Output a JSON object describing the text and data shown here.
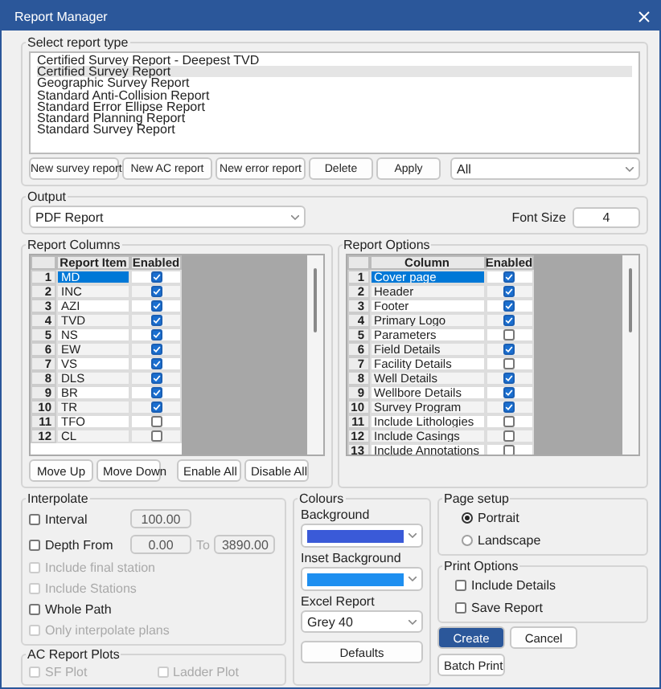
{
  "window": {
    "title": "Report Manager"
  },
  "report_type": {
    "label": "Select report type",
    "items": [
      {
        "label": "Certified Survey Report - Deepest TVD",
        "selected": false
      },
      {
        "label": "Certified Survey Report",
        "selected": true
      },
      {
        "label": "Geographic Survey Report",
        "selected": false
      },
      {
        "label": "Standard Anti-Collision Report",
        "selected": false
      },
      {
        "label": "Standard Error Ellipse Report",
        "selected": false
      },
      {
        "label": "Standard Planning Report",
        "selected": false
      },
      {
        "label": "Standard Survey Report",
        "selected": false
      }
    ],
    "buttons": [
      "New survey report",
      "New AC report",
      "New error report",
      "Delete",
      "Apply"
    ],
    "filter": {
      "value": "All"
    }
  },
  "output": {
    "label": "Output",
    "format": {
      "value": "PDF Report"
    },
    "font_size": {
      "label": "Font Size",
      "value": "4"
    }
  },
  "report_columns": {
    "label": "Report Columns",
    "headers": [
      "Report Item",
      "Enabled"
    ],
    "rows": [
      {
        "number": "1",
        "item": "MD",
        "enabled": true,
        "selected": true
      },
      {
        "number": "2",
        "item": "INC",
        "enabled": true,
        "selected": false
      },
      {
        "number": "3",
        "item": "AZI",
        "enabled": true,
        "selected": false
      },
      {
        "number": "4",
        "item": "TVD",
        "enabled": true,
        "selected": false
      },
      {
        "number": "5",
        "item": "NS",
        "enabled": true,
        "selected": false
      },
      {
        "number": "6",
        "item": "EW",
        "enabled": true,
        "selected": false
      },
      {
        "number": "7",
        "item": "VS",
        "enabled": true,
        "selected": false
      },
      {
        "number": "8",
        "item": "DLS",
        "enabled": true,
        "selected": false
      },
      {
        "number": "9",
        "item": "BR",
        "enabled": true,
        "selected": false
      },
      {
        "number": "10",
        "item": "TR",
        "enabled": true,
        "selected": false
      },
      {
        "number": "11",
        "item": "TFO",
        "enabled": false,
        "selected": false
      },
      {
        "number": "12",
        "item": "CL",
        "enabled": false,
        "selected": false
      }
    ],
    "buttons": [
      "Move Up",
      "Move Down",
      "Enable All",
      "Disable All"
    ]
  },
  "report_options": {
    "label": "Report Options",
    "headers": [
      "Column",
      "Enabled"
    ],
    "rows": [
      {
        "number": "1",
        "item": "Cover page",
        "enabled": true,
        "selected": true
      },
      {
        "number": "2",
        "item": "Header",
        "enabled": true,
        "selected": false
      },
      {
        "number": "3",
        "item": "Footer",
        "enabled": true,
        "selected": false
      },
      {
        "number": "4",
        "item": "Primary Logo",
        "enabled": true,
        "selected": false
      },
      {
        "number": "5",
        "item": "Parameters",
        "enabled": false,
        "selected": false
      },
      {
        "number": "6",
        "item": "Field Details",
        "enabled": true,
        "selected": false
      },
      {
        "number": "7",
        "item": "Facility Details",
        "enabled": false,
        "selected": false
      },
      {
        "number": "8",
        "item": "Well Details",
        "enabled": true,
        "selected": false
      },
      {
        "number": "9",
        "item": "Wellbore Details",
        "enabled": true,
        "selected": false
      },
      {
        "number": "10",
        "item": "Survey Program",
        "enabled": true,
        "selected": false
      },
      {
        "number": "11",
        "item": "Include Lithologies",
        "enabled": false,
        "selected": false
      },
      {
        "number": "12",
        "item": "Include Casings",
        "enabled": false,
        "selected": false
      },
      {
        "number": "13",
        "item": "Include Annotations",
        "enabled": false,
        "selected": false
      }
    ]
  },
  "interpolate": {
    "label": "Interpolate",
    "options": [
      {
        "kind": "field",
        "label": "Interval",
        "checked": false,
        "disabled": false,
        "value": "100.00"
      },
      {
        "kind": "range",
        "label": "Depth From",
        "checked": false,
        "disabled": false,
        "value": "0.00",
        "to_label": "To",
        "to_value": "3890.00"
      },
      {
        "kind": "plain",
        "label": "Include final station",
        "checked": false,
        "disabled": true
      },
      {
        "kind": "plain",
        "label": "Include Stations",
        "checked": false,
        "disabled": true
      },
      {
        "kind": "plain",
        "label": "Whole Path",
        "checked": false,
        "disabled": false
      },
      {
        "kind": "plain",
        "label": "Only interpolate plans",
        "checked": false,
        "disabled": true
      }
    ]
  },
  "ac_report_plots": {
    "label": "AC Report Plots",
    "options": [
      {
        "label": "SF Plot",
        "checked": false,
        "disabled": true
      },
      {
        "label": "Ladder Plot",
        "checked": false,
        "disabled": true
      }
    ]
  },
  "colours": {
    "label": "Colours",
    "fields": [
      {
        "kind": "color",
        "label": "Background",
        "color": "#3a5ad8"
      },
      {
        "kind": "color",
        "label": "Inset Background",
        "color": "#1e8ff0"
      },
      {
        "kind": "select",
        "label": "Excel Report",
        "value": "Grey 40"
      }
    ],
    "button": "Defaults"
  },
  "page_setup": {
    "label": "Page setup",
    "options": [
      {
        "label": "Portrait",
        "selected": true
      },
      {
        "label": "Landscape",
        "selected": false
      }
    ]
  },
  "print_options": {
    "label": "Print Options",
    "options": [
      {
        "label": "Include Details",
        "checked": false
      },
      {
        "label": "Save Report",
        "checked": false
      }
    ]
  },
  "actions": [
    {
      "label": "Create",
      "primary": true
    },
    {
      "label": "Cancel",
      "primary": false
    },
    {
      "label": "Batch Print",
      "primary": false
    }
  ]
}
